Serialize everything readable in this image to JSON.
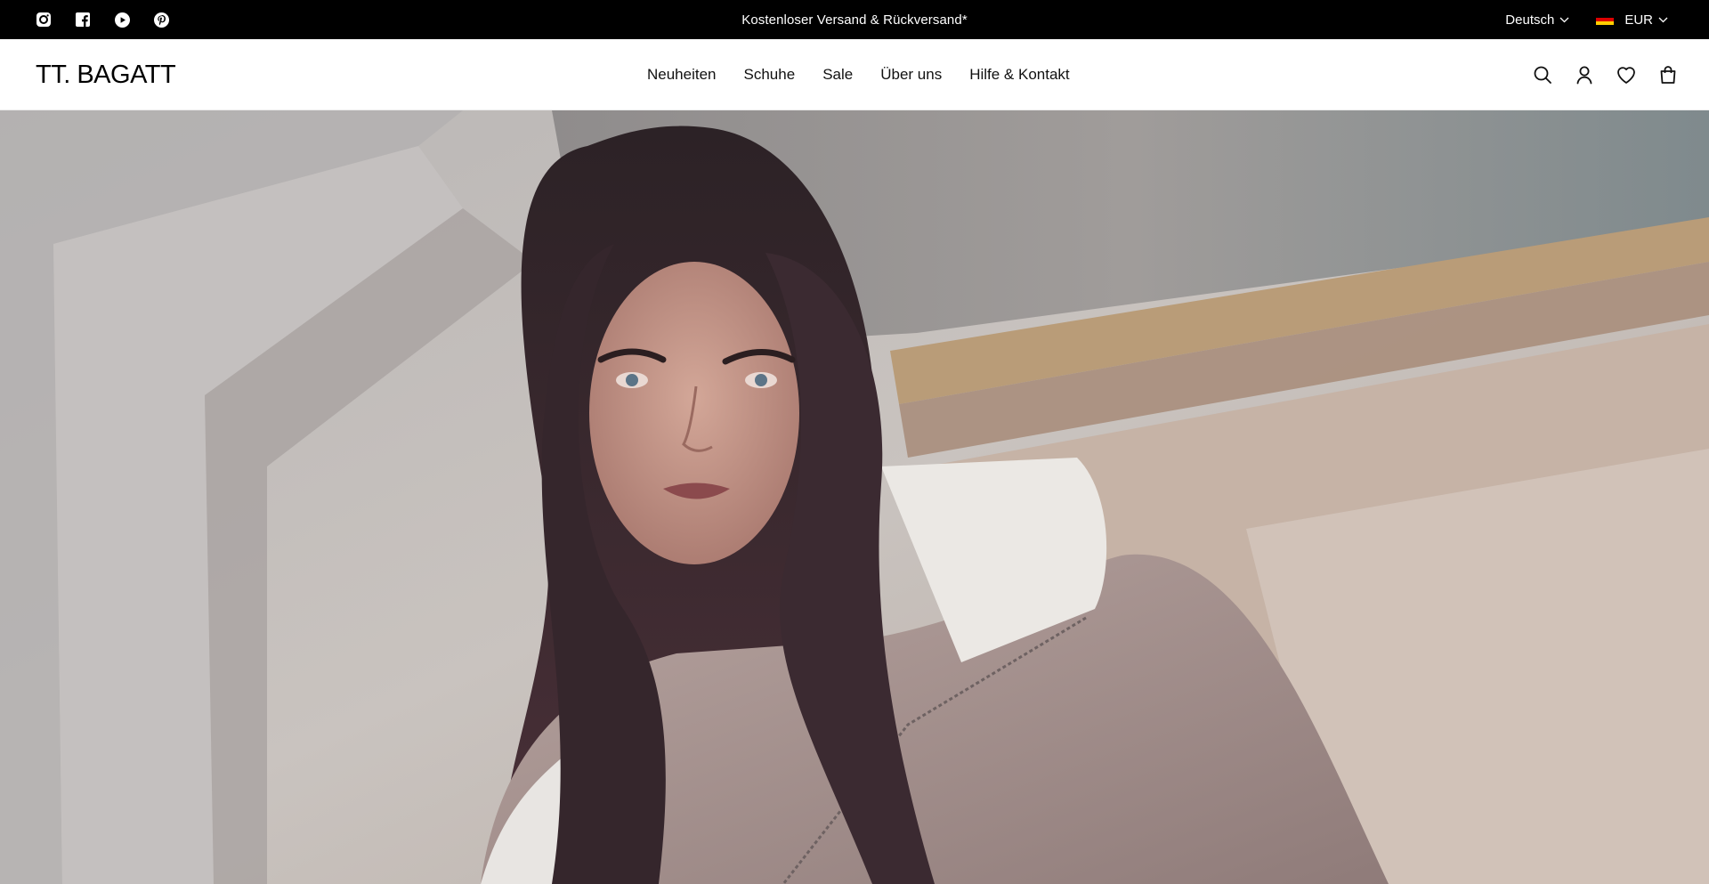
{
  "topbar": {
    "social": [
      {
        "name": "instagram-icon"
      },
      {
        "name": "facebook-icon"
      },
      {
        "name": "youtube-icon"
      },
      {
        "name": "pinterest-icon"
      }
    ],
    "announcement": "Kostenloser Versand & Rückversand*",
    "language": "Deutsch",
    "currency": "EUR"
  },
  "header": {
    "logo": "TT. BAGATT",
    "nav": [
      "Neuheiten",
      "Schuhe",
      "Sale",
      "Über uns",
      "Hilfe & Kontakt"
    ],
    "actions": [
      {
        "name": "search-icon"
      },
      {
        "name": "account-icon"
      },
      {
        "name": "wishlist-icon"
      },
      {
        "name": "cart-icon"
      }
    ]
  },
  "hero": {
    "media": "hero-video"
  },
  "colors": {
    "topbar_bg": "#000000",
    "header_bg": "#ffffff",
    "text": "#111111"
  }
}
